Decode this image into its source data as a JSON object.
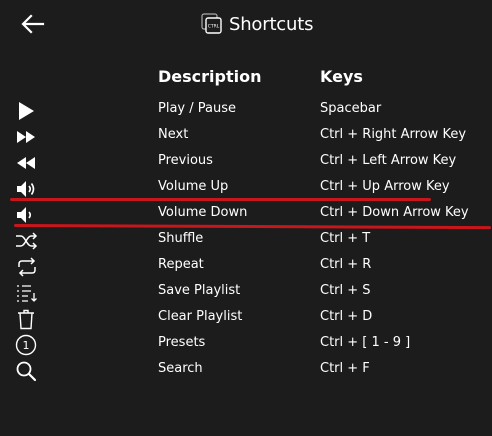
{
  "header": {
    "title": "Shortcuts",
    "ctrl_icon_label": "CTRL"
  },
  "columns": {
    "description": "Description",
    "keys": "Keys"
  },
  "shortcuts": [
    {
      "icon": "play-icon",
      "description": "Play / Pause",
      "keys": "Spacebar"
    },
    {
      "icon": "next-icon",
      "description": "Next",
      "keys": "Ctrl + Right Arrow Key"
    },
    {
      "icon": "previous-icon",
      "description": "Previous",
      "keys": "Ctrl + Left Arrow Key"
    },
    {
      "icon": "volume-up-icon",
      "description": "Volume Up",
      "keys": "Ctrl + Up Arrow Key"
    },
    {
      "icon": "volume-down-icon",
      "description": "Volume Down",
      "keys": "Ctrl + Down Arrow Key"
    },
    {
      "icon": "shuffle-icon",
      "description": "Shuffle",
      "keys": "Ctrl + T"
    },
    {
      "icon": "repeat-icon",
      "description": "Repeat",
      "keys": "Ctrl + R"
    },
    {
      "icon": "playlist-icon",
      "description": "Save Playlist",
      "keys": "Ctrl + S"
    },
    {
      "icon": "trash-icon",
      "description": "Clear Playlist",
      "keys": "Ctrl + D"
    },
    {
      "icon": "preset-icon",
      "description": "Presets",
      "keys": "Ctrl + [ 1 - 9 ]"
    },
    {
      "icon": "search-icon",
      "description": "Search",
      "keys": "Ctrl + F"
    }
  ],
  "preset_icon_digit": "1",
  "colors": {
    "background": "#1c1c1c",
    "text": "#ffffff",
    "highlight_line": "#c8161d"
  }
}
